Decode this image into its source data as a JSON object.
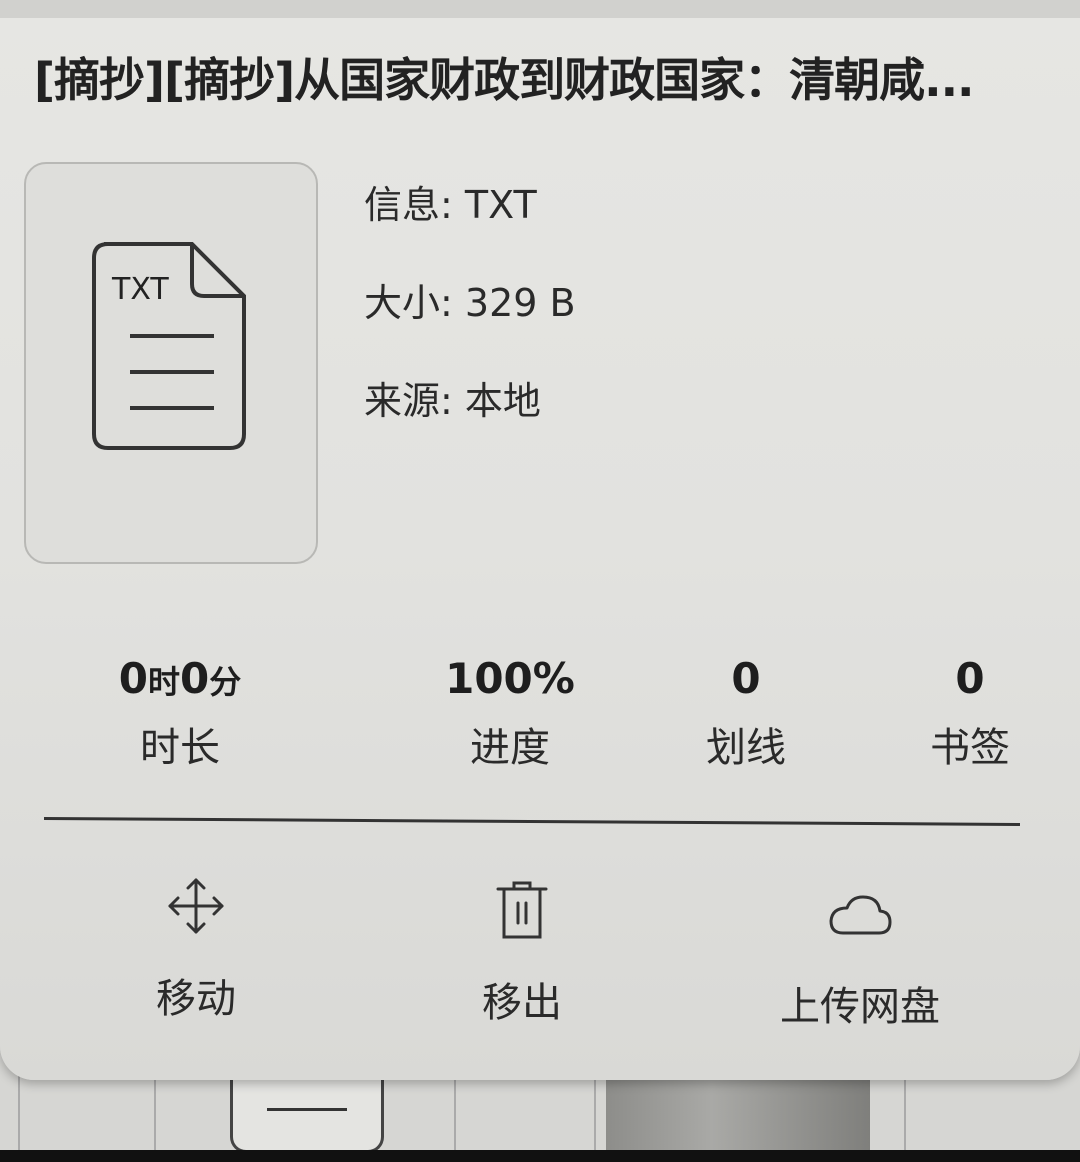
{
  "title": "[摘抄][摘抄]从国家财政到财政国家：清朝咸...",
  "cover": {
    "label": "TXT"
  },
  "info": [
    {
      "key": "信息: ",
      "value": "TXT"
    },
    {
      "key": "大小: ",
      "value": "329 B"
    },
    {
      "key": "来源: ",
      "value": "本地"
    }
  ],
  "stats": [
    {
      "value_num1": "0",
      "value_unit1": "时",
      "value_num2": "0",
      "value_unit2": "分",
      "label": "时长"
    },
    {
      "value": "100%",
      "label": "进度"
    },
    {
      "value": "0",
      "label": "划线"
    },
    {
      "value": "0",
      "label": "书签"
    }
  ],
  "actions": [
    {
      "label": "移动",
      "icon": "move-arrows-icon"
    },
    {
      "label": "移出",
      "icon": "trash-icon"
    },
    {
      "label": "上传网盘",
      "icon": "cloud-icon"
    }
  ]
}
